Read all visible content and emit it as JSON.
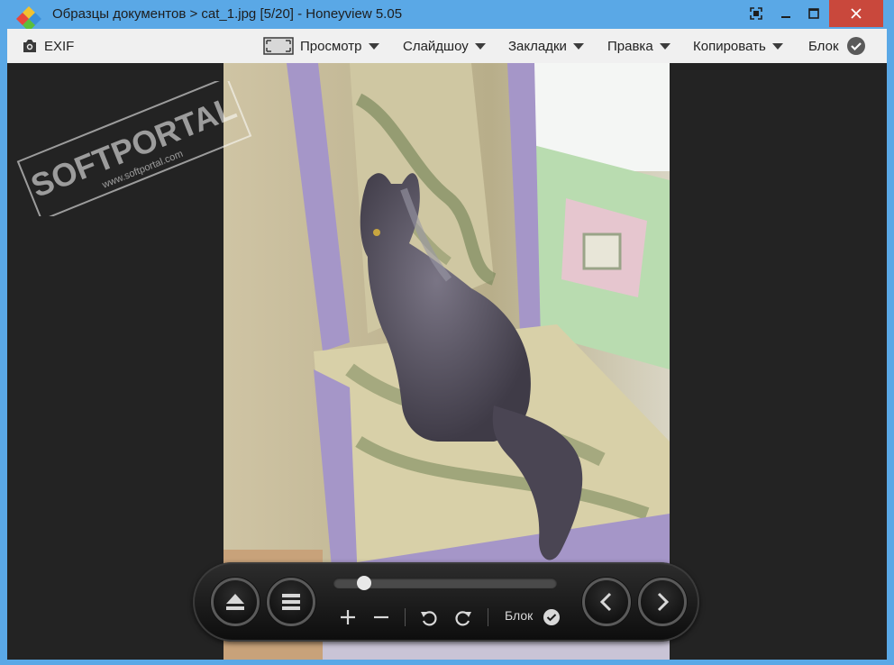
{
  "window": {
    "title": "Образцы документов > cat_1.jpg [5/20] - Honeyview 5.05",
    "close_color": "#c9483c",
    "titlebar_color": "#5aa8e6"
  },
  "menubar": {
    "exif_label": "EXIF",
    "view_label": "Просмотр",
    "slideshow_label": "Слайдшоу",
    "bookmarks_label": "Закладки",
    "edit_label": "Правка",
    "copy_label": "Копировать",
    "lock_label": "Блок"
  },
  "watermark": {
    "brand": "SOFTPORTAL",
    "url": "www.softportal.com"
  },
  "controls": {
    "slider_position": 0.11,
    "lock_label": "Блок"
  },
  "icons": [
    "app-logo-icon",
    "fullscreen-icon",
    "minimize-icon",
    "maximize-icon",
    "close-icon",
    "camera-icon",
    "view-mode-icon",
    "check-icon",
    "eject-icon",
    "menu-icon",
    "zoom-in-icon",
    "zoom-out-icon",
    "rotate-left-icon",
    "rotate-right-icon",
    "prev-icon",
    "next-icon"
  ]
}
